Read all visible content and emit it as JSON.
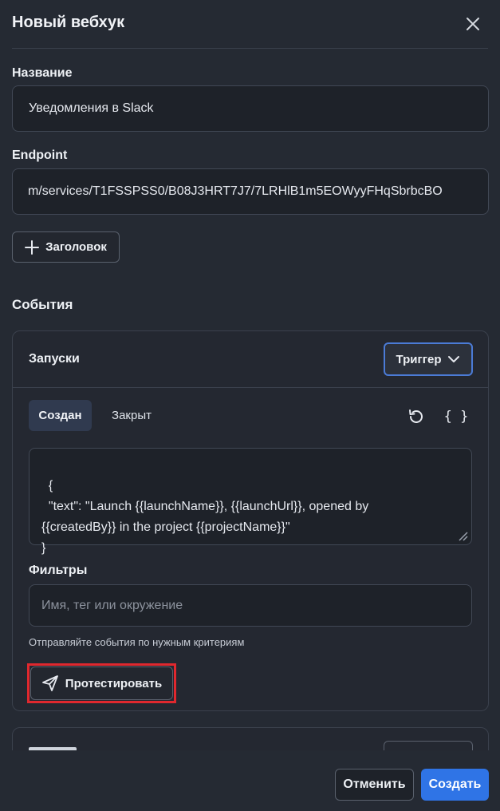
{
  "dialog": {
    "title": "Новый вебхук"
  },
  "name_field": {
    "label": "Название",
    "value": "Уведомления в Slack"
  },
  "endpoint_field": {
    "label": "Endpoint",
    "value": "m/services/T1FSSPSS0/B08J3HRT7J7/7LRHlB1m5EOWyyFHqSbrbcBO"
  },
  "add_header_button": {
    "label": "Заголовок"
  },
  "events": {
    "title": "События",
    "launches_card": {
      "title": "Запуски",
      "trigger_label": "Триггер",
      "tabs": [
        "Создан",
        "Закрыт"
      ],
      "braces_label": "{ }",
      "payload": "{\n  \"text\": \"Launch {{launchName}}, {{launchUrl}}, opened by\n{{createdBy}} in the project {{projectName}}\"\n}",
      "filters_label": "Фильтры",
      "filters_placeholder": "Имя, тег или окружение",
      "filters_hint": "Отправляйте события по нужным критериям",
      "test_button_label": "Протестировать"
    }
  },
  "footer": {
    "cancel_label": "Отменить",
    "create_label": "Создать"
  },
  "colors": {
    "background": "#252a33",
    "accent": "#2f74e6",
    "highlight": "#e0282e"
  },
  "icons": [
    "close-icon",
    "plus-icon",
    "chevron-down-icon",
    "reset-icon",
    "send-icon"
  ]
}
